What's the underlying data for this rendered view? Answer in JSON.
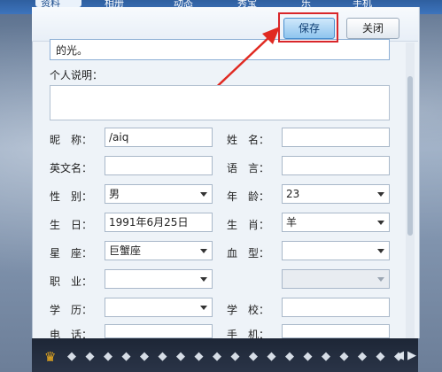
{
  "tabs": [
    {
      "label": "资料",
      "active": true
    },
    {
      "label": "相册",
      "active": false
    },
    {
      "label": "动态",
      "active": false
    },
    {
      "label": "秀宝",
      "active": false
    },
    {
      "label": "乐",
      "active": false
    },
    {
      "label": "手机",
      "active": false
    }
  ],
  "toolbar": {
    "save_label": "保存",
    "close_label": "关闭"
  },
  "signature": {
    "value": "的光。"
  },
  "personal_note": {
    "label": "个人说明：",
    "value": ""
  },
  "form": {
    "nickname_label": "昵　称：",
    "nickname_value": "/aiq",
    "name_label": "姓　名：",
    "name_value": "",
    "english_name_label": "英文名：",
    "english_name_value": "",
    "language_label": "语　言：",
    "language_value": "",
    "gender_label": "性　别：",
    "gender_value": "男",
    "age_label": "年　龄：",
    "age_value": "23",
    "birthday_label": "生　日：",
    "birthday_value": "1991年6月25日",
    "zodiac_label": "生　肖：",
    "zodiac_value": "羊",
    "star_label": "星　座：",
    "star_value": "巨蟹座",
    "blood_label": "血　型：",
    "blood_value": "",
    "job_label": "职　业：",
    "job_value": "",
    "job_detail_value": "",
    "education_label": "学　历：",
    "education_value": "",
    "school_label": "学　校：",
    "school_value": "",
    "phone_label": "电　话：",
    "mobile_label": "手　机："
  },
  "colors": {
    "accent": "#8fc5ee",
    "highlight": "#d9262a"
  },
  "icons": [
    "crown-icon",
    "gem-icon",
    "gem-icon",
    "gem-icon",
    "gem-icon",
    "gem-icon",
    "gem-icon",
    "gem-icon",
    "gem-icon",
    "gem-icon",
    "gem-icon",
    "gem-icon",
    "gem-icon",
    "gem-icon",
    "gem-icon",
    "gem-icon",
    "gem-icon",
    "gem-icon",
    "gem-icon",
    "gem-icon"
  ]
}
